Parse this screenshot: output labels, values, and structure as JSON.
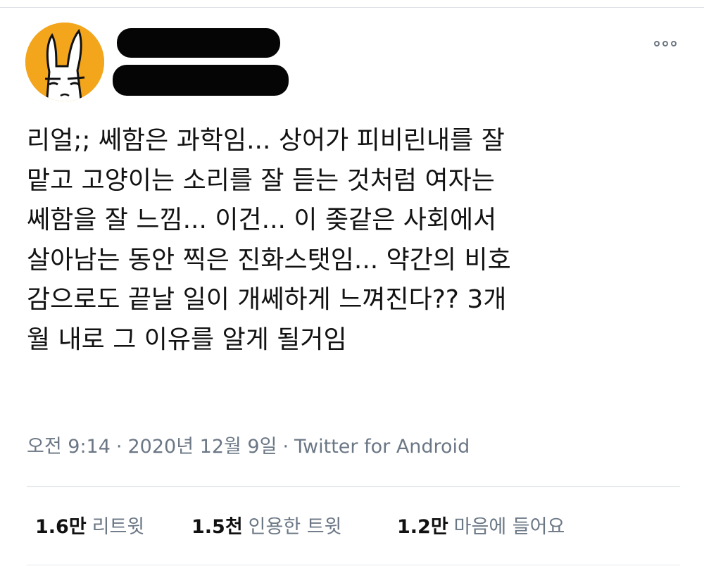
{
  "tweet": {
    "author": {
      "avatar_icon": "cartoon-rabbit-avatar-icon",
      "avatar_color": "#f3a51c"
    },
    "more_icon": "more-options-icon",
    "body_lines": [
      "리얼;; 쎄함은 과학임... 상어가 피비린내를 잘",
      "맡고 고양이는 소리를 잘 듣는 것처럼 여자는",
      "쎄함을 잘 느낌... 이건... 이 좆같은 사회에서",
      "살아남는 동안 찍은 진화스탯임... 약간의 비호",
      "감으로도 끝날 일이 개쎄하게 느껴진다?? 3개",
      "월 내로 그 이유를 알게 될거임"
    ],
    "time": "오전 9:14",
    "date": "2020년 12월 9일",
    "separator": "·",
    "source": "Twitter for Android",
    "stats": {
      "retweets": {
        "count": "1.6만",
        "label": "리트윗"
      },
      "quotes": {
        "count": "1.5천",
        "label": "인용한 트윗"
      },
      "likes": {
        "count": "1.2만",
        "label": "마음에 들어요"
      }
    }
  }
}
